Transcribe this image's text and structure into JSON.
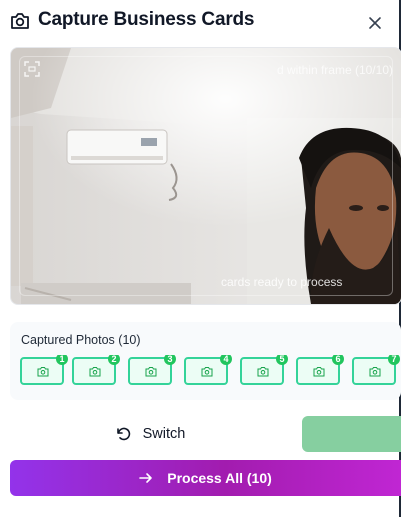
{
  "header": {
    "title": "Capture Business Cards",
    "icon": "camera-icon",
    "close_icon": "close-icon"
  },
  "preview": {
    "frame_icon": "scan-frame-icon",
    "frame_status": "d within frame (10/10)",
    "ready_status": "cards ready to process"
  },
  "captured": {
    "label": "Captured Photos (10)",
    "thumbs": [
      {
        "badge": "1"
      },
      {
        "badge": "2"
      },
      {
        "badge": "3"
      },
      {
        "badge": "4"
      },
      {
        "badge": "5"
      },
      {
        "badge": "6"
      },
      {
        "badge": "7"
      }
    ]
  },
  "actions": {
    "switch_label": "Switch",
    "switch_icon": "rotate-ccw-icon",
    "process_label": "Process All (10)",
    "process_icon": "arrow-right-icon"
  },
  "colors": {
    "accent_green": "#34d399",
    "capture_button": "#86cfa0",
    "process_gradient_start": "#9333ea",
    "process_gradient_end": "#c026d3"
  }
}
